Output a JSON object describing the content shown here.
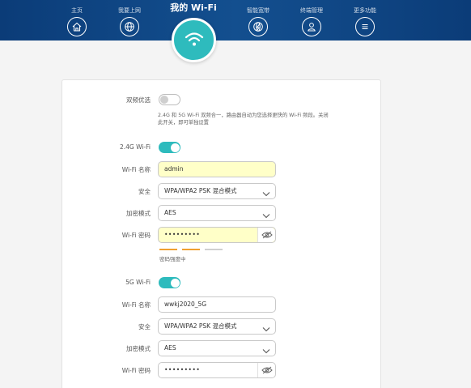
{
  "nav": {
    "items": [
      {
        "label": "主页",
        "icon": "home-icon"
      },
      {
        "label": "我要上网",
        "icon": "globe-icon"
      },
      {
        "label": "智能宽带",
        "icon": "speed-globe-icon"
      },
      {
        "label": "终端管理",
        "icon": "user-icon"
      },
      {
        "label": "更多功能",
        "icon": "menu-icon"
      }
    ],
    "active": {
      "label": "我的 Wi-Fi",
      "icon": "wifi-icon"
    }
  },
  "dual_band": {
    "label": "双频优选",
    "enabled": false,
    "description": "2.4G 和 5G Wi-Fi 双频合一，路由器自动为您选择更快的 Wi-Fi 频段。关闭此开关，即可单独设置"
  },
  "band_24g": {
    "label": "2.4G Wi-Fi",
    "enabled": true,
    "name_label": "Wi-Fi 名称",
    "name_value": "admin",
    "security_label": "安全",
    "security_value": "WPA/WPA2 PSK 混合模式",
    "encryption_label": "加密模式",
    "encryption_value": "AES",
    "password_label": "Wi-Fi 密码",
    "password_value": "•••••••••",
    "strength_text": "密码强度中",
    "strength_level": 0.67
  },
  "band_5g": {
    "label": "5G Wi-Fi",
    "enabled": true,
    "name_label": "Wi-Fi 名称",
    "name_value": "wwkj2020_5G",
    "security_label": "安全",
    "security_value": "WPA/WPA2 PSK 混合模式",
    "encryption_label": "加密模式",
    "encryption_value": "AES",
    "password_label": "Wi-Fi 密码",
    "password_value": "•••••••••"
  },
  "colors": {
    "header": "#0b3c78",
    "accent": "#2ebbbd",
    "autofill": "#ffffc8",
    "strength_active": "#f0a030",
    "strength_inactive": "#d0d0d0"
  }
}
